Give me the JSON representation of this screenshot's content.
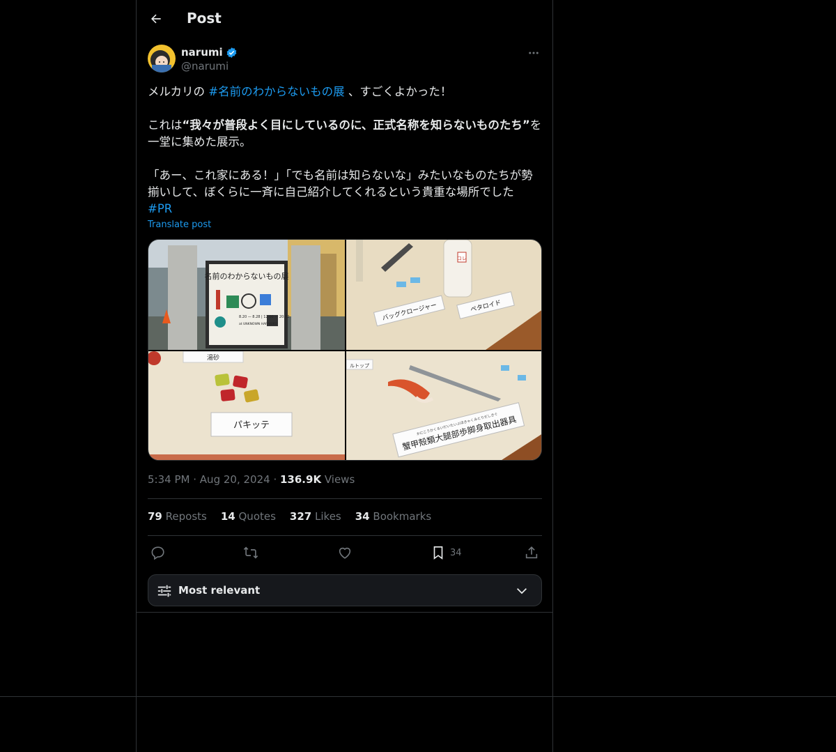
{
  "header": {
    "title": "Post"
  },
  "author": {
    "name": "narumi",
    "handle": "@narumi"
  },
  "post": {
    "line1_pre": "メルカリの ",
    "line1_tag": "#名前のわからないもの展",
    "line1_post": " 、すごくよかった！",
    "line2_pre": "これは",
    "line2_bold": "“我々が普段よく目にしているのに、正式名称を知らないものたち”",
    "line2_post": "を一堂に集めた展示。",
    "line3": "「あー、これ家にある！」「でも名前は知らないな」みたいなものたちが勢揃いして、ぼくらに一斉に自己紹介してくれるという貴重な場所でした",
    "tag2": "#PR",
    "translate": "Translate post"
  },
  "media": {
    "img1": {
      "sign_title": "名前のわからないもの展",
      "dates": "8.20 — 8.28 | 12:00 — 20:00",
      "venue": "at UNKNOWN HARAJUKU"
    },
    "img2": {
      "label1": "バッグクロージャー",
      "label2": "ペタロイド",
      "bottle_tag": "コレ"
    },
    "img3": {
      "label_top": "湯砂",
      "label": "パキッテ"
    },
    "img4": {
      "label_small": "かにこうかくるいだいたいぶほきゃくみとりだしきぐ",
      "label": "蟹甲殻類大腿部歩脚身取出器具",
      "label_left": "ルトップ"
    }
  },
  "meta": {
    "time": "5:34 PM",
    "dot": "·",
    "date": "Aug 20, 2024",
    "views_count": "136.9K",
    "views_label": "Views"
  },
  "stats": [
    {
      "count": "79",
      "label": "Reposts"
    },
    {
      "count": "14",
      "label": "Quotes"
    },
    {
      "count": "327",
      "label": "Likes"
    },
    {
      "count": "34",
      "label": "Bookmarks"
    }
  ],
  "actions": {
    "bookmark_count": "34"
  },
  "sort": {
    "label": "Most relevant"
  },
  "colors": {
    "accent": "#1d9bf0",
    "text": "#e7e9ea",
    "muted": "#71767b",
    "border": "#2f3336",
    "background": "#000000"
  },
  "icons": [
    "back-arrow-icon",
    "verified-badge-icon",
    "more-dots-icon",
    "reply-icon",
    "repost-icon",
    "like-icon",
    "bookmark-icon",
    "share-icon",
    "sliders-icon",
    "chevron-down-icon"
  ]
}
